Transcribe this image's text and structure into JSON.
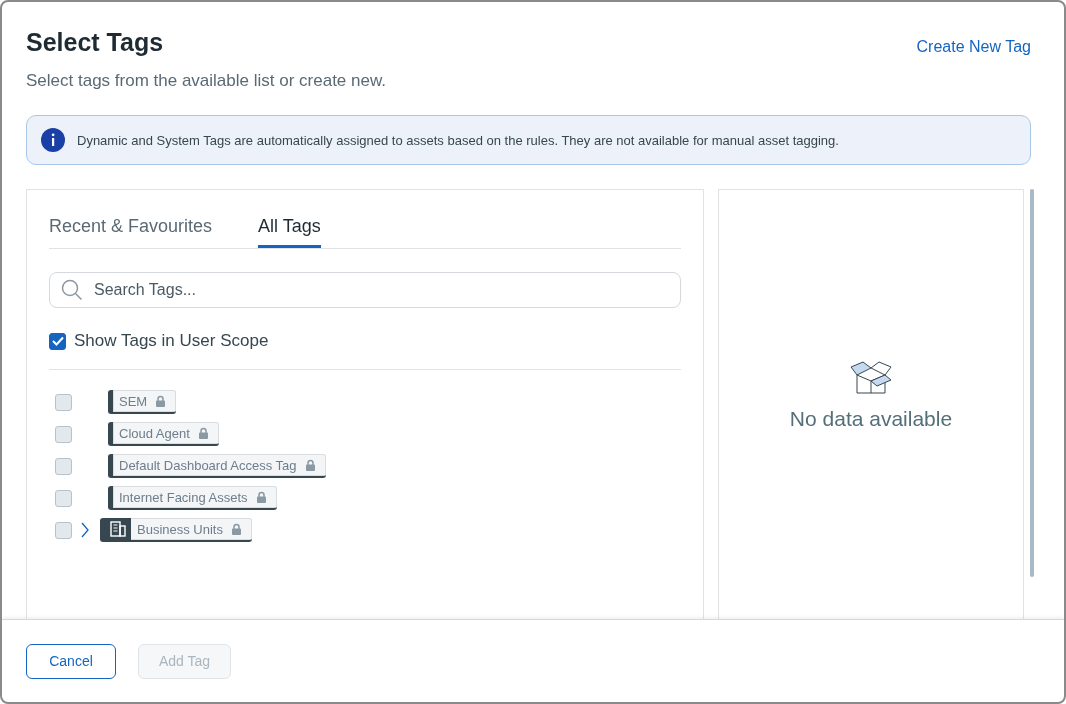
{
  "dialog": {
    "title": "Select Tags",
    "subtitle": "Select tags from the available list or create new.",
    "create_link": "Create New Tag"
  },
  "info_banner": {
    "text": "Dynamic and System Tags are automatically assigned to assets based on the rules. They are not available for manual asset tagging."
  },
  "tabs": [
    {
      "label": "Recent & Favourites",
      "selected": false
    },
    {
      "label": "All Tags",
      "selected": true
    }
  ],
  "search": {
    "placeholder": "Search Tags..."
  },
  "scope_checkbox": {
    "label": "Show Tags in User Scope",
    "checked": true
  },
  "tags": [
    {
      "label": "SEM",
      "kind": "static",
      "checked": false,
      "locked": true
    },
    {
      "label": "Cloud Agent",
      "kind": "static",
      "checked": false,
      "locked": true
    },
    {
      "label": "Default Dashboard Access Tag",
      "kind": "static",
      "checked": false,
      "locked": true
    },
    {
      "label": "Internet Facing Assets",
      "kind": "static",
      "checked": false,
      "locked": true
    },
    {
      "label": "Business Units",
      "kind": "group",
      "checked": false,
      "locked": true,
      "expanded": false
    }
  ],
  "selected_panel": {
    "empty_text": "No data available"
  },
  "buttons": [
    {
      "label": "Cancel",
      "disabled": false
    },
    {
      "label": "Add Tag",
      "disabled": true
    }
  ]
}
